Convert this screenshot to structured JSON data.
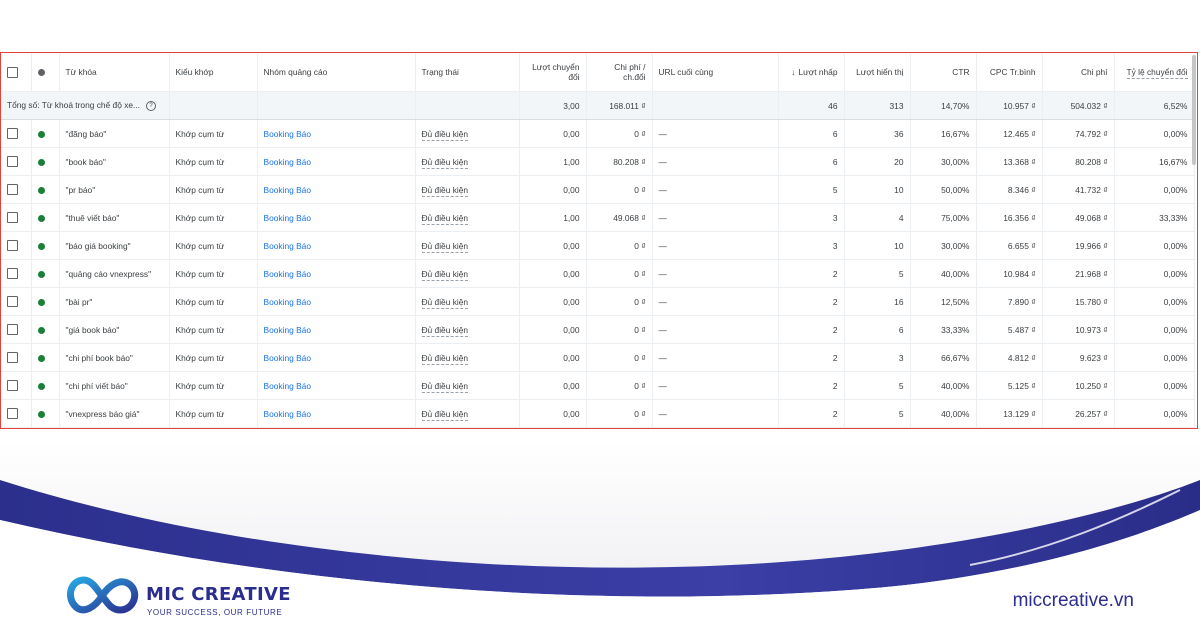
{
  "colors": {
    "status_dot_green": "#188038",
    "status_dot_gray": "#5f6368",
    "link_blue": "#1a73e8",
    "frame_red": "#e0443a",
    "brand_navy": "#2b2e8f"
  },
  "table": {
    "headers": {
      "keyword": "Từ khóa",
      "match_type": "Kiểu khớp",
      "ad_group": "Nhóm quảng cáo",
      "status": "Trạng thái",
      "conversions": "Lượt chuyển đổi",
      "cost_per_conv": "Chi phí / ch.đổi",
      "final_url": "URL cuối cùng",
      "clicks": "Lượt nhấp",
      "impressions": "Lượt hiển thị",
      "ctr": "CTR",
      "avg_cpc": "CPC Tr.bình",
      "cost": "Chi phí",
      "conv_rate": "Tỷ lệ chuyển đổi"
    },
    "sort_icon": "arrow-down-icon",
    "total": {
      "label": "Tổng số: Từ khoá trong chế độ xe...",
      "conversions": "3,00",
      "cost_per_conv": "168.011 ₫",
      "clicks": "46",
      "impressions": "313",
      "ctr": "14,70%",
      "avg_cpc": "10.957 ₫",
      "cost": "504.032 ₫",
      "conv_rate": "6,52%"
    },
    "rows": [
      {
        "keyword": "\"đăng báo\"",
        "match_type": "Khớp cụm từ",
        "ad_group": "Booking Báo",
        "status": "Đủ điều kiện",
        "conversions": "0,00",
        "cost_per_conv": "0 ₫",
        "final_url": "—",
        "clicks": "6",
        "impressions": "36",
        "ctr": "16,67%",
        "avg_cpc": "12.465 ₫",
        "cost": "74.792 ₫",
        "conv_rate": "0,00%"
      },
      {
        "keyword": "\"book báo\"",
        "match_type": "Khớp cụm từ",
        "ad_group": "Booking Báo",
        "status": "Đủ điều kiện",
        "conversions": "1,00",
        "cost_per_conv": "80.208 ₫",
        "final_url": "—",
        "clicks": "6",
        "impressions": "20",
        "ctr": "30,00%",
        "avg_cpc": "13.368 ₫",
        "cost": "80.208 ₫",
        "conv_rate": "16,67%"
      },
      {
        "keyword": "\"pr báo\"",
        "match_type": "Khớp cụm từ",
        "ad_group": "Booking Báo",
        "status": "Đủ điều kiện",
        "conversions": "0,00",
        "cost_per_conv": "0 ₫",
        "final_url": "—",
        "clicks": "5",
        "impressions": "10",
        "ctr": "50,00%",
        "avg_cpc": "8.346 ₫",
        "cost": "41.732 ₫",
        "conv_rate": "0,00%"
      },
      {
        "keyword": "\"thuê viết báo\"",
        "match_type": "Khớp cụm từ",
        "ad_group": "Booking Báo",
        "status": "Đủ điều kiện",
        "conversions": "1,00",
        "cost_per_conv": "49.068 ₫",
        "final_url": "—",
        "clicks": "3",
        "impressions": "4",
        "ctr": "75,00%",
        "avg_cpc": "16.356 ₫",
        "cost": "49.068 ₫",
        "conv_rate": "33,33%"
      },
      {
        "keyword": "\"báo giá booking\"",
        "match_type": "Khớp cụm từ",
        "ad_group": "Booking Báo",
        "status": "Đủ điều kiện",
        "conversions": "0,00",
        "cost_per_conv": "0 ₫",
        "final_url": "—",
        "clicks": "3",
        "impressions": "10",
        "ctr": "30,00%",
        "avg_cpc": "6.655 ₫",
        "cost": "19.966 ₫",
        "conv_rate": "0,00%"
      },
      {
        "keyword": "\"quảng cáo vnexpress\"",
        "match_type": "Khớp cụm từ",
        "ad_group": "Booking Báo",
        "status": "Đủ điều kiện",
        "conversions": "0,00",
        "cost_per_conv": "0 ₫",
        "final_url": "—",
        "clicks": "2",
        "impressions": "5",
        "ctr": "40,00%",
        "avg_cpc": "10.984 ₫",
        "cost": "21.968 ₫",
        "conv_rate": "0,00%"
      },
      {
        "keyword": "\"bài pr\"",
        "match_type": "Khớp cụm từ",
        "ad_group": "Booking Báo",
        "status": "Đủ điều kiện",
        "conversions": "0,00",
        "cost_per_conv": "0 ₫",
        "final_url": "—",
        "clicks": "2",
        "impressions": "16",
        "ctr": "12,50%",
        "avg_cpc": "7.890 ₫",
        "cost": "15.780 ₫",
        "conv_rate": "0,00%"
      },
      {
        "keyword": "\"giá book báo\"",
        "match_type": "Khớp cụm từ",
        "ad_group": "Booking Báo",
        "status": "Đủ điều kiện",
        "conversions": "0,00",
        "cost_per_conv": "0 ₫",
        "final_url": "—",
        "clicks": "2",
        "impressions": "6",
        "ctr": "33,33%",
        "avg_cpc": "5.487 ₫",
        "cost": "10.973 ₫",
        "conv_rate": "0,00%"
      },
      {
        "keyword": "\"chi phí book báo\"",
        "match_type": "Khớp cụm từ",
        "ad_group": "Booking Báo",
        "status": "Đủ điều kiện",
        "conversions": "0,00",
        "cost_per_conv": "0 ₫",
        "final_url": "—",
        "clicks": "2",
        "impressions": "3",
        "ctr": "66,67%",
        "avg_cpc": "4.812 ₫",
        "cost": "9.623 ₫",
        "conv_rate": "0,00%"
      },
      {
        "keyword": "\"chi phí viết báo\"",
        "match_type": "Khớp cụm từ",
        "ad_group": "Booking Báo",
        "status": "Đủ điều kiện",
        "conversions": "0,00",
        "cost_per_conv": "0 ₫",
        "final_url": "—",
        "clicks": "2",
        "impressions": "5",
        "ctr": "40,00%",
        "avg_cpc": "5.125 ₫",
        "cost": "10.250 ₫",
        "conv_rate": "0,00%"
      },
      {
        "keyword": "\"vnexpress báo giá\"",
        "match_type": "Khớp cụm từ",
        "ad_group": "Booking Báo",
        "status": "Đủ điều kiện",
        "conversions": "0,00",
        "cost_per_conv": "0 ₫",
        "final_url": "—",
        "clicks": "2",
        "impressions": "5",
        "ctr": "40,00%",
        "avg_cpc": "13.129 ₫",
        "cost": "26.257 ₫",
        "conv_rate": "0,00%"
      }
    ]
  },
  "brand": {
    "logo_icon": "infinity-logo-icon",
    "name": "MIC CREATIVE",
    "tagline": "YOUR SUCCESS, OUR FUTURE",
    "website": "miccreative.vn"
  }
}
